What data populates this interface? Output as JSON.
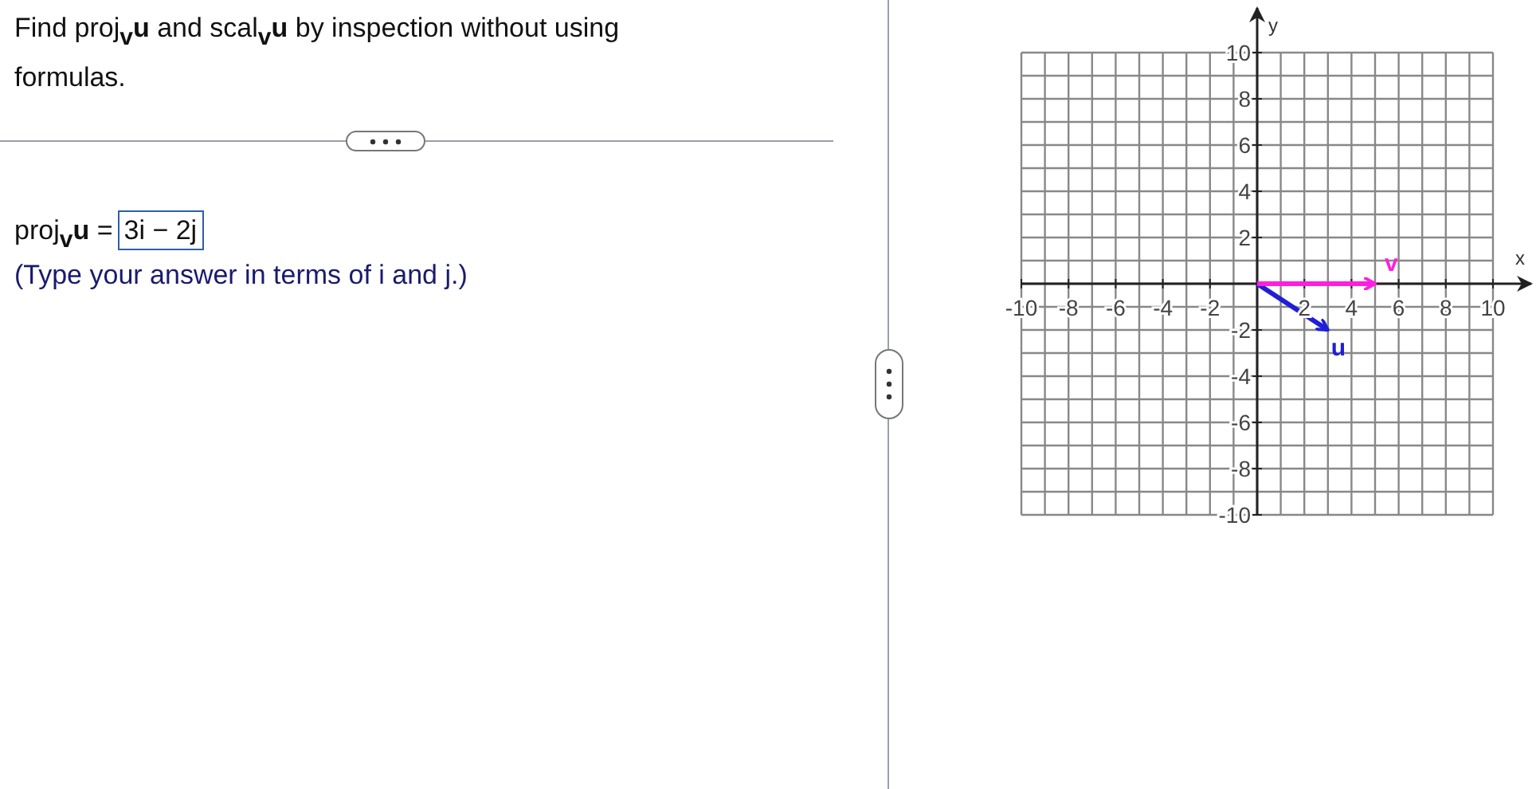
{
  "question": "Find proj$_{v}$**u** and scal$_{v}$**u** by inspection without using formulas.",
  "answer": {
    "label": "proj$_{v}$**u** =",
    "value": "3i − 2j",
    "hint": "(Type your answer in terms of i and j.)"
  },
  "graph": {
    "chart_data": {
      "type": "line",
      "grid": true,
      "xlabel": "x",
      "ylabel": "y",
      "xlim": [
        -10,
        10
      ],
      "ylim": [
        -10,
        10
      ],
      "xticks": [
        -10,
        -8,
        -6,
        -4,
        -2,
        2,
        4,
        6,
        8,
        10
      ],
      "yticks": [
        -10,
        -8,
        -6,
        -4,
        -2,
        2,
        4,
        6,
        8,
        10
      ],
      "series": [
        {
          "name": "u",
          "color": "#1f1fd6",
          "x": [
            0,
            3
          ],
          "values": [
            0,
            -2
          ]
        },
        {
          "name": "v",
          "color": "#ff1fe0",
          "x": [
            0,
            5
          ],
          "values": [
            0,
            0
          ]
        }
      ]
    }
  }
}
